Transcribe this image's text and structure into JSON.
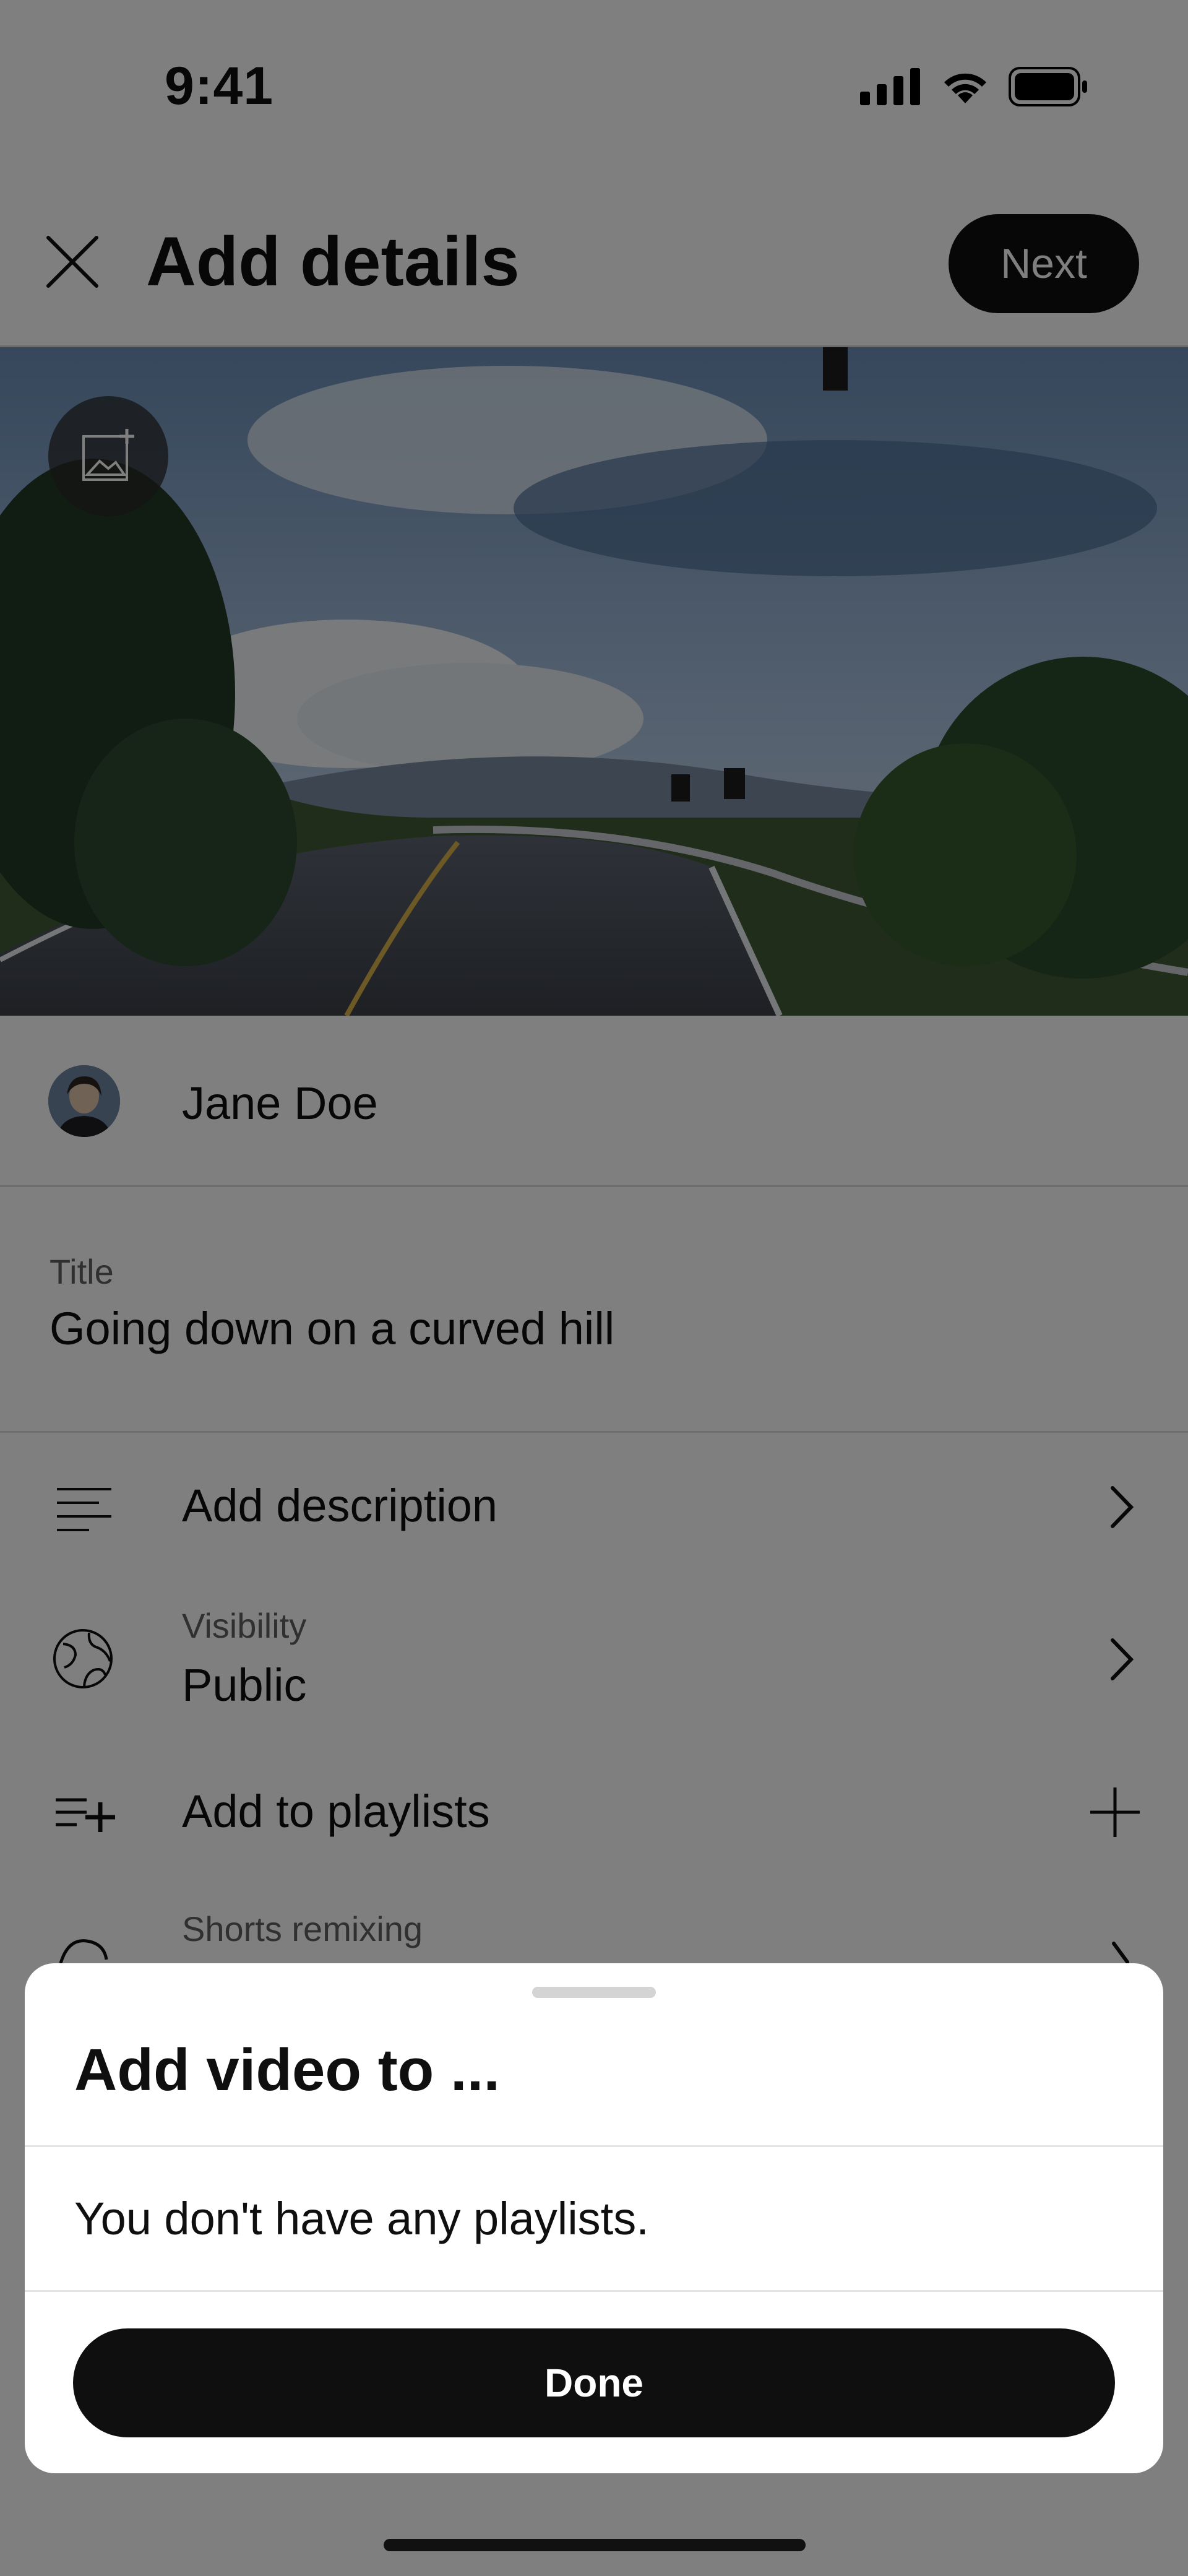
{
  "status_bar": {
    "time": "9:41"
  },
  "header": {
    "title": "Add details",
    "next_label": "Next"
  },
  "channel": {
    "name": "Jane Doe"
  },
  "title_field": {
    "label": "Title",
    "value": "Going down on a curved hill"
  },
  "rows": {
    "description": {
      "label": "Add description"
    },
    "visibility": {
      "label": "Visibility",
      "value": "Public"
    },
    "playlists": {
      "label": "Add to playlists"
    },
    "remixing": {
      "label": "Shorts remixing"
    }
  },
  "sheet": {
    "title": "Add video to ...",
    "message": "You don't have any playlists.",
    "done_label": "Done"
  },
  "colors": {
    "accent": "#0f0f0f",
    "overlay": "rgba(0,0,0,0.5)",
    "sheet_bg": "#ffffff"
  }
}
